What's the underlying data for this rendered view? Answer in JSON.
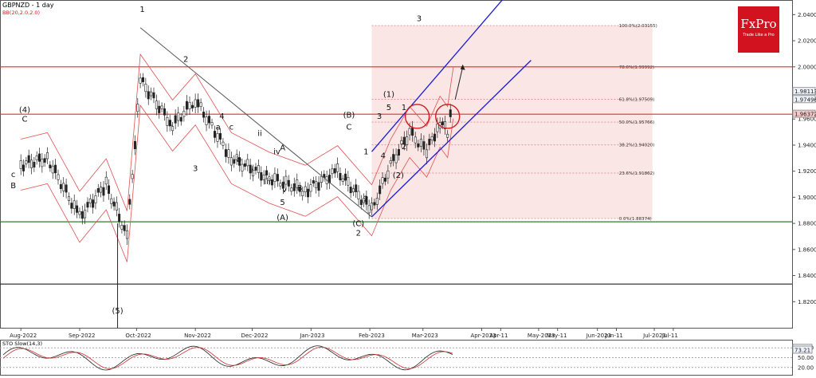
{
  "title": "GBPNZD - 1 day",
  "indicator": "BB(20,2.0,2.0)",
  "stoch_label": "STO Slow(14,3)",
  "brand": {
    "name": "FxPro",
    "tagline": "Trade Like a Pro",
    "color": "#d3121f"
  },
  "chart_data": {
    "type": "line",
    "price": {
      "x": [
        "2022-08-01",
        "2022-08-15",
        "2022-09-01",
        "2022-09-15",
        "2022-09-26",
        "2022-10-03",
        "2022-10-20",
        "2022-11-01",
        "2022-11-20",
        "2022-12-10",
        "2022-12-29",
        "2023-01-15",
        "2023-02-02",
        "2023-02-12",
        "2023-02-22",
        "2023-03-03",
        "2023-03-10",
        "2023-03-14",
        "2023-03-17"
      ],
      "values": [
        1.925,
        1.93,
        1.885,
        1.91,
        1.87,
        1.99,
        1.955,
        1.975,
        1.93,
        1.915,
        1.905,
        1.92,
        1.89,
        1.925,
        1.95,
        1.935,
        1.958,
        1.95,
        1.98
      ],
      "ylim": [
        1.8,
        2.05
      ],
      "yticks": [
        "1.82000",
        "1.84000",
        "1.86000",
        "1.88000",
        "1.90000",
        "1.92000",
        "1.94000",
        "1.96000",
        "1.98000",
        "2.00000",
        "2.02000",
        "2.04000"
      ],
      "xticks": [
        "Aug-2022",
        "Sep-2022",
        "Oct-2022",
        "Nov-2022",
        "Dec-2022",
        "Jan-2023",
        "Feb-2023",
        "Mar-2023",
        "Apr-2023",
        "Apr-11",
        "May-2023",
        "May-11",
        "Jun-2023",
        "Jun-11",
        "Jul-2023",
        "Jul-11"
      ]
    },
    "horizontal_levels": [
      {
        "value": 2.0,
        "color": "#e03030"
      },
      {
        "value": 1.9637,
        "color": "#e03030"
      },
      {
        "value": 1.8812,
        "color": "#2e7d32"
      },
      {
        "value": 1.8335,
        "color": "#222222"
      }
    ],
    "price_markers": [
      {
        "label": "1.98113",
        "value": 1.98113
      },
      {
        "label": "1.97496",
        "value": 1.97496
      },
      {
        "label": "1.96372",
        "value": 1.96372
      }
    ],
    "fibonacci": {
      "range_dates": [
        "2023-02-02",
        "2023-06-30"
      ],
      "levels": [
        {
          "label": "100.0%(2.03155)",
          "value": 2.03155
        },
        {
          "label": "78.6%(1.99992)",
          "value": 1.99992
        },
        {
          "label": "61.8%(1.97509)",
          "value": 1.97509
        },
        {
          "label": "50.0%(1.95766)",
          "value": 1.95766
        },
        {
          "label": "38.2%(1.94020)",
          "value": 1.9402
        },
        {
          "label": "23.6%(1.91862)",
          "value": 1.91862
        },
        {
          "label": "0.0%(1.88374)",
          "value": 1.88374
        }
      ]
    },
    "trendline": {
      "from": {
        "date": "2022-10-03",
        "value": 2.03
      },
      "to": {
        "date": "2023-02-02",
        "value": 1.885
      }
    },
    "channel": [
      {
        "from": {
          "date": "2023-02-02",
          "value": 1.935
        },
        "to": {
          "date": "2023-04-17",
          "value": 2.06
        }
      },
      {
        "from": {
          "date": "2023-02-02",
          "value": 1.885
        },
        "to": {
          "date": "2023-04-27",
          "value": 2.005
        }
      }
    ],
    "projection": {
      "from": {
        "date": "2023-03-18",
        "value": 1.975
      },
      "to": {
        "date": "2023-03-22",
        "value": 2.0
      }
    },
    "circles": [
      {
        "date": "2023-02-26",
        "value": 1.962
      },
      {
        "date": "2023-03-14",
        "value": 1.962
      }
    ],
    "wave_labels": [
      {
        "text": "(4)",
        "date": "2022-08-03",
        "value": 1.965
      },
      {
        "text": "C",
        "date": "2022-08-03",
        "value": 1.958
      },
      {
        "text": "c",
        "date": "2022-07-28",
        "value": 1.9155
      },
      {
        "text": "B",
        "date": "2022-07-28",
        "value": 1.907
      },
      {
        "text": "1",
        "date": "2022-10-04",
        "value": 2.042
      },
      {
        "text": "2",
        "date": "2022-10-27",
        "value": 2.004
      },
      {
        "text": "1",
        "date": "2022-10-19",
        "value": 1.955
      },
      {
        "text": "3",
        "date": "2022-11-01",
        "value": 1.92
      },
      {
        "text": "4",
        "date": "2022-11-15",
        "value": 1.96
      },
      {
        "text": "a",
        "date": "2022-11-13",
        "value": 1.952
      },
      {
        "text": "c",
        "date": "2022-11-20",
        "value": 1.952
      },
      {
        "text": "b",
        "date": "2022-11-24",
        "value": 1.927
      },
      {
        "text": "i",
        "date": "2022-12-01",
        "value": 1.919
      },
      {
        "text": "ii",
        "date": "2022-12-05",
        "value": 1.947
      },
      {
        "text": "iii",
        "date": "2022-12-09",
        "value": 1.91
      },
      {
        "text": "iv",
        "date": "2022-12-14",
        "value": 1.933
      },
      {
        "text": "A",
        "date": "2022-12-17",
        "value": 1.936
      },
      {
        "text": "v",
        "date": "2022-12-18",
        "value": 1.904
      },
      {
        "text": "B",
        "date": "2022-12-26",
        "value": 1.905
      },
      {
        "text": "5",
        "date": "2022-12-17",
        "value": 1.894
      },
      {
        "text": "(A)",
        "date": "2022-12-17",
        "value": 1.8825
      },
      {
        "text": "(B)",
        "date": "2023-01-21",
        "value": 1.961
      },
      {
        "text": "C",
        "date": "2023-01-21",
        "value": 1.952
      },
      {
        "text": "(C)",
        "date": "2023-01-26",
        "value": 1.878
      },
      {
        "text": "2",
        "date": "2023-01-26",
        "value": 1.8705
      },
      {
        "text": "1",
        "date": "2023-01-30",
        "value": 1.933
      },
      {
        "text": "2",
        "date": "2023-01-30",
        "value": 1.897
      },
      {
        "text": "3",
        "date": "2023-02-06",
        "value": 1.96
      },
      {
        "text": "4",
        "date": "2023-02-08",
        "value": 1.93
      },
      {
        "text": "5",
        "date": "2023-02-11",
        "value": 1.967
      },
      {
        "text": "(1)",
        "date": "2023-02-11",
        "value": 1.977
      },
      {
        "text": "(2)",
        "date": "2023-02-16",
        "value": 1.915
      },
      {
        "text": "1",
        "date": "2023-02-19",
        "value": 1.967
      },
      {
        "text": "2",
        "date": "2023-02-19",
        "value": 1.937
      },
      {
        "text": "3",
        "date": "2023-02-27",
        "value": 2.035
      },
      {
        "text": "(3)",
        "date": "2023-02-27",
        "value": 2.058
      },
      {
        "text": "(5)",
        "date": "2022-09-21",
        "value": 1.811
      }
    ],
    "stochastic": {
      "ylim": [
        0,
        100
      ],
      "yticks": [
        "20.00",
        "50.00",
        "80.00"
      ],
      "current": [
        "78.78",
        "73.21"
      ]
    }
  }
}
